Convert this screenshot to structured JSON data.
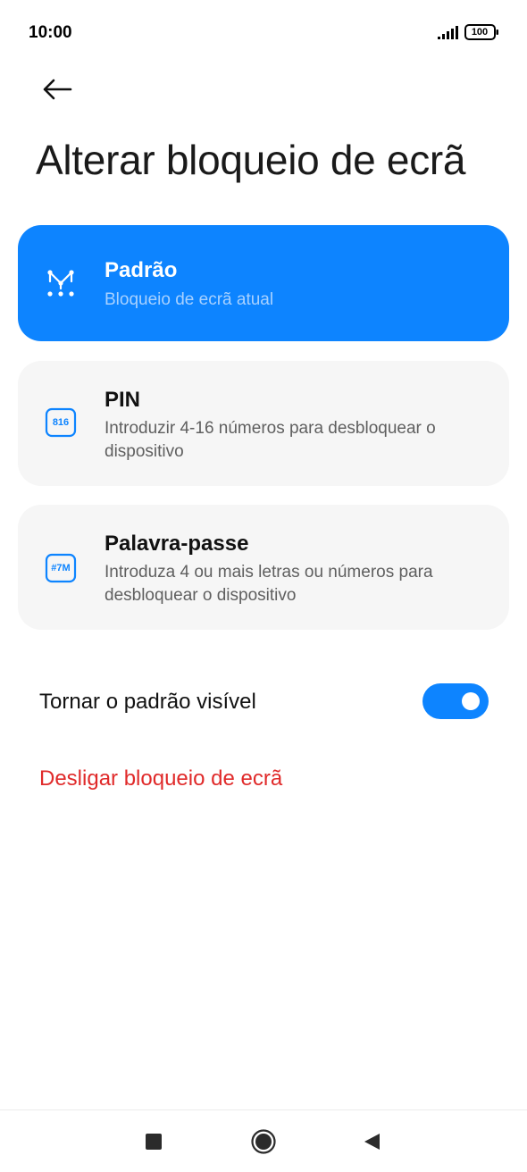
{
  "status_bar": {
    "time": "10:00",
    "battery": "100",
    "icons": [
      "signal-icon",
      "battery-icon"
    ]
  },
  "header": {
    "back_icon": "arrow-left-icon",
    "title": "Alterar bloqueio de ecrã"
  },
  "options": [
    {
      "title": "Padrão",
      "description": "Bloqueio de ecrã atual",
      "icon": "pattern-icon",
      "selected": true
    },
    {
      "title": "PIN",
      "description": "Introduzir 4-16 números para desbloquear o dispositivo",
      "icon": "pin-icon",
      "icon_text": "816",
      "selected": false
    },
    {
      "title": "Palavra-passe",
      "description": "Introduza 4 ou mais letras ou números para desbloquear o dispositivo",
      "icon": "password-icon",
      "icon_text": "#7M",
      "selected": false
    }
  ],
  "visible_pattern": {
    "label": "Tornar o padrão visível",
    "enabled": true
  },
  "turn_off": {
    "label": "Desligar bloqueio de ecrã"
  },
  "nav_bar": {
    "icons": [
      "recents-square-icon",
      "home-circle-icon",
      "back-triangle-icon"
    ]
  },
  "colors": {
    "accent": "#0d84ff",
    "selected_subtitle": "#a8d1ff",
    "card_background": "#f6f6f6",
    "danger": "#e02a2a"
  }
}
